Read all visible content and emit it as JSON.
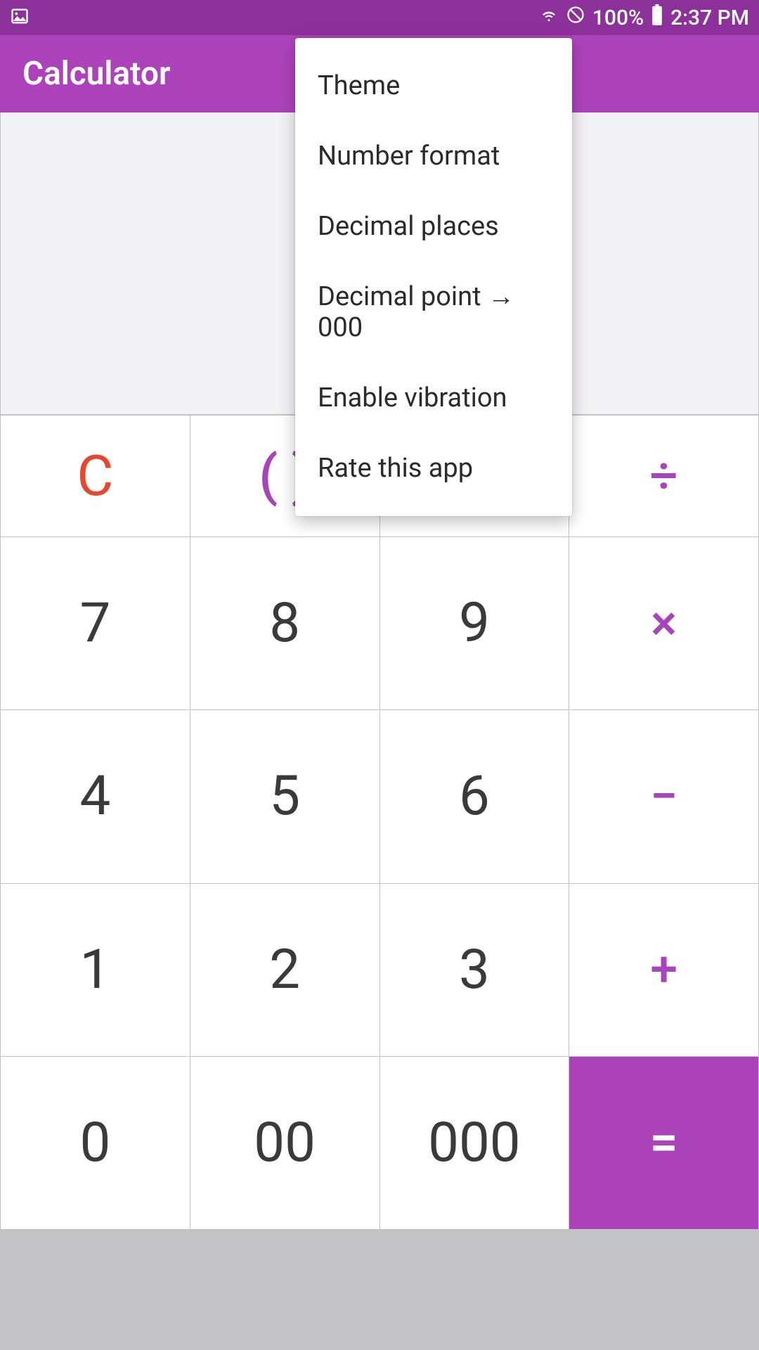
{
  "status": {
    "battery": "100%",
    "time": "2:37 PM"
  },
  "appbar": {
    "title": "Calculator"
  },
  "menu": {
    "items": [
      "Theme",
      "Number format",
      "Decimal places",
      "Decimal point → 000",
      "Enable vibration",
      "Rate this app"
    ]
  },
  "keys": {
    "clear": "C",
    "parens": "( )",
    "divide": "÷",
    "multiply": "×",
    "minus": "−",
    "plus": "+",
    "equals": "=",
    "n7": "7",
    "n8": "8",
    "n9": "9",
    "n4": "4",
    "n5": "5",
    "n6": "6",
    "n1": "1",
    "n2": "2",
    "n3": "3",
    "n0": "0",
    "z2": "00",
    "z3": "000"
  }
}
